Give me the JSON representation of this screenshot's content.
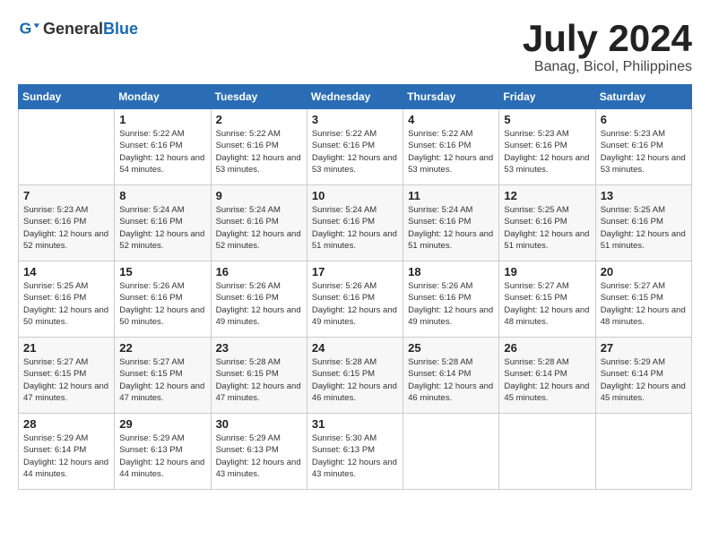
{
  "header": {
    "logo_general": "General",
    "logo_blue": "Blue",
    "month_year": "July 2024",
    "location": "Banag, Bicol, Philippines"
  },
  "weekdays": [
    "Sunday",
    "Monday",
    "Tuesday",
    "Wednesday",
    "Thursday",
    "Friday",
    "Saturday"
  ],
  "weeks": [
    [
      {
        "day": "",
        "sunrise": "",
        "sunset": "",
        "daylight": ""
      },
      {
        "day": "1",
        "sunrise": "Sunrise: 5:22 AM",
        "sunset": "Sunset: 6:16 PM",
        "daylight": "Daylight: 12 hours and 54 minutes."
      },
      {
        "day": "2",
        "sunrise": "Sunrise: 5:22 AM",
        "sunset": "Sunset: 6:16 PM",
        "daylight": "Daylight: 12 hours and 53 minutes."
      },
      {
        "day": "3",
        "sunrise": "Sunrise: 5:22 AM",
        "sunset": "Sunset: 6:16 PM",
        "daylight": "Daylight: 12 hours and 53 minutes."
      },
      {
        "day": "4",
        "sunrise": "Sunrise: 5:22 AM",
        "sunset": "Sunset: 6:16 PM",
        "daylight": "Daylight: 12 hours and 53 minutes."
      },
      {
        "day": "5",
        "sunrise": "Sunrise: 5:23 AM",
        "sunset": "Sunset: 6:16 PM",
        "daylight": "Daylight: 12 hours and 53 minutes."
      },
      {
        "day": "6",
        "sunrise": "Sunrise: 5:23 AM",
        "sunset": "Sunset: 6:16 PM",
        "daylight": "Daylight: 12 hours and 53 minutes."
      }
    ],
    [
      {
        "day": "7",
        "sunrise": "Sunrise: 5:23 AM",
        "sunset": "Sunset: 6:16 PM",
        "daylight": "Daylight: 12 hours and 52 minutes."
      },
      {
        "day": "8",
        "sunrise": "Sunrise: 5:24 AM",
        "sunset": "Sunset: 6:16 PM",
        "daylight": "Daylight: 12 hours and 52 minutes."
      },
      {
        "day": "9",
        "sunrise": "Sunrise: 5:24 AM",
        "sunset": "Sunset: 6:16 PM",
        "daylight": "Daylight: 12 hours and 52 minutes."
      },
      {
        "day": "10",
        "sunrise": "Sunrise: 5:24 AM",
        "sunset": "Sunset: 6:16 PM",
        "daylight": "Daylight: 12 hours and 51 minutes."
      },
      {
        "day": "11",
        "sunrise": "Sunrise: 5:24 AM",
        "sunset": "Sunset: 6:16 PM",
        "daylight": "Daylight: 12 hours and 51 minutes."
      },
      {
        "day": "12",
        "sunrise": "Sunrise: 5:25 AM",
        "sunset": "Sunset: 6:16 PM",
        "daylight": "Daylight: 12 hours and 51 minutes."
      },
      {
        "day": "13",
        "sunrise": "Sunrise: 5:25 AM",
        "sunset": "Sunset: 6:16 PM",
        "daylight": "Daylight: 12 hours and 51 minutes."
      }
    ],
    [
      {
        "day": "14",
        "sunrise": "Sunrise: 5:25 AM",
        "sunset": "Sunset: 6:16 PM",
        "daylight": "Daylight: 12 hours and 50 minutes."
      },
      {
        "day": "15",
        "sunrise": "Sunrise: 5:26 AM",
        "sunset": "Sunset: 6:16 PM",
        "daylight": "Daylight: 12 hours and 50 minutes."
      },
      {
        "day": "16",
        "sunrise": "Sunrise: 5:26 AM",
        "sunset": "Sunset: 6:16 PM",
        "daylight": "Daylight: 12 hours and 49 minutes."
      },
      {
        "day": "17",
        "sunrise": "Sunrise: 5:26 AM",
        "sunset": "Sunset: 6:16 PM",
        "daylight": "Daylight: 12 hours and 49 minutes."
      },
      {
        "day": "18",
        "sunrise": "Sunrise: 5:26 AM",
        "sunset": "Sunset: 6:16 PM",
        "daylight": "Daylight: 12 hours and 49 minutes."
      },
      {
        "day": "19",
        "sunrise": "Sunrise: 5:27 AM",
        "sunset": "Sunset: 6:15 PM",
        "daylight": "Daylight: 12 hours and 48 minutes."
      },
      {
        "day": "20",
        "sunrise": "Sunrise: 5:27 AM",
        "sunset": "Sunset: 6:15 PM",
        "daylight": "Daylight: 12 hours and 48 minutes."
      }
    ],
    [
      {
        "day": "21",
        "sunrise": "Sunrise: 5:27 AM",
        "sunset": "Sunset: 6:15 PM",
        "daylight": "Daylight: 12 hours and 47 minutes."
      },
      {
        "day": "22",
        "sunrise": "Sunrise: 5:27 AM",
        "sunset": "Sunset: 6:15 PM",
        "daylight": "Daylight: 12 hours and 47 minutes."
      },
      {
        "day": "23",
        "sunrise": "Sunrise: 5:28 AM",
        "sunset": "Sunset: 6:15 PM",
        "daylight": "Daylight: 12 hours and 47 minutes."
      },
      {
        "day": "24",
        "sunrise": "Sunrise: 5:28 AM",
        "sunset": "Sunset: 6:15 PM",
        "daylight": "Daylight: 12 hours and 46 minutes."
      },
      {
        "day": "25",
        "sunrise": "Sunrise: 5:28 AM",
        "sunset": "Sunset: 6:14 PM",
        "daylight": "Daylight: 12 hours and 46 minutes."
      },
      {
        "day": "26",
        "sunrise": "Sunrise: 5:28 AM",
        "sunset": "Sunset: 6:14 PM",
        "daylight": "Daylight: 12 hours and 45 minutes."
      },
      {
        "day": "27",
        "sunrise": "Sunrise: 5:29 AM",
        "sunset": "Sunset: 6:14 PM",
        "daylight": "Daylight: 12 hours and 45 minutes."
      }
    ],
    [
      {
        "day": "28",
        "sunrise": "Sunrise: 5:29 AM",
        "sunset": "Sunset: 6:14 PM",
        "daylight": "Daylight: 12 hours and 44 minutes."
      },
      {
        "day": "29",
        "sunrise": "Sunrise: 5:29 AM",
        "sunset": "Sunset: 6:13 PM",
        "daylight": "Daylight: 12 hours and 44 minutes."
      },
      {
        "day": "30",
        "sunrise": "Sunrise: 5:29 AM",
        "sunset": "Sunset: 6:13 PM",
        "daylight": "Daylight: 12 hours and 43 minutes."
      },
      {
        "day": "31",
        "sunrise": "Sunrise: 5:30 AM",
        "sunset": "Sunset: 6:13 PM",
        "daylight": "Daylight: 12 hours and 43 minutes."
      },
      {
        "day": "",
        "sunrise": "",
        "sunset": "",
        "daylight": ""
      },
      {
        "day": "",
        "sunrise": "",
        "sunset": "",
        "daylight": ""
      },
      {
        "day": "",
        "sunrise": "",
        "sunset": "",
        "daylight": ""
      }
    ]
  ]
}
